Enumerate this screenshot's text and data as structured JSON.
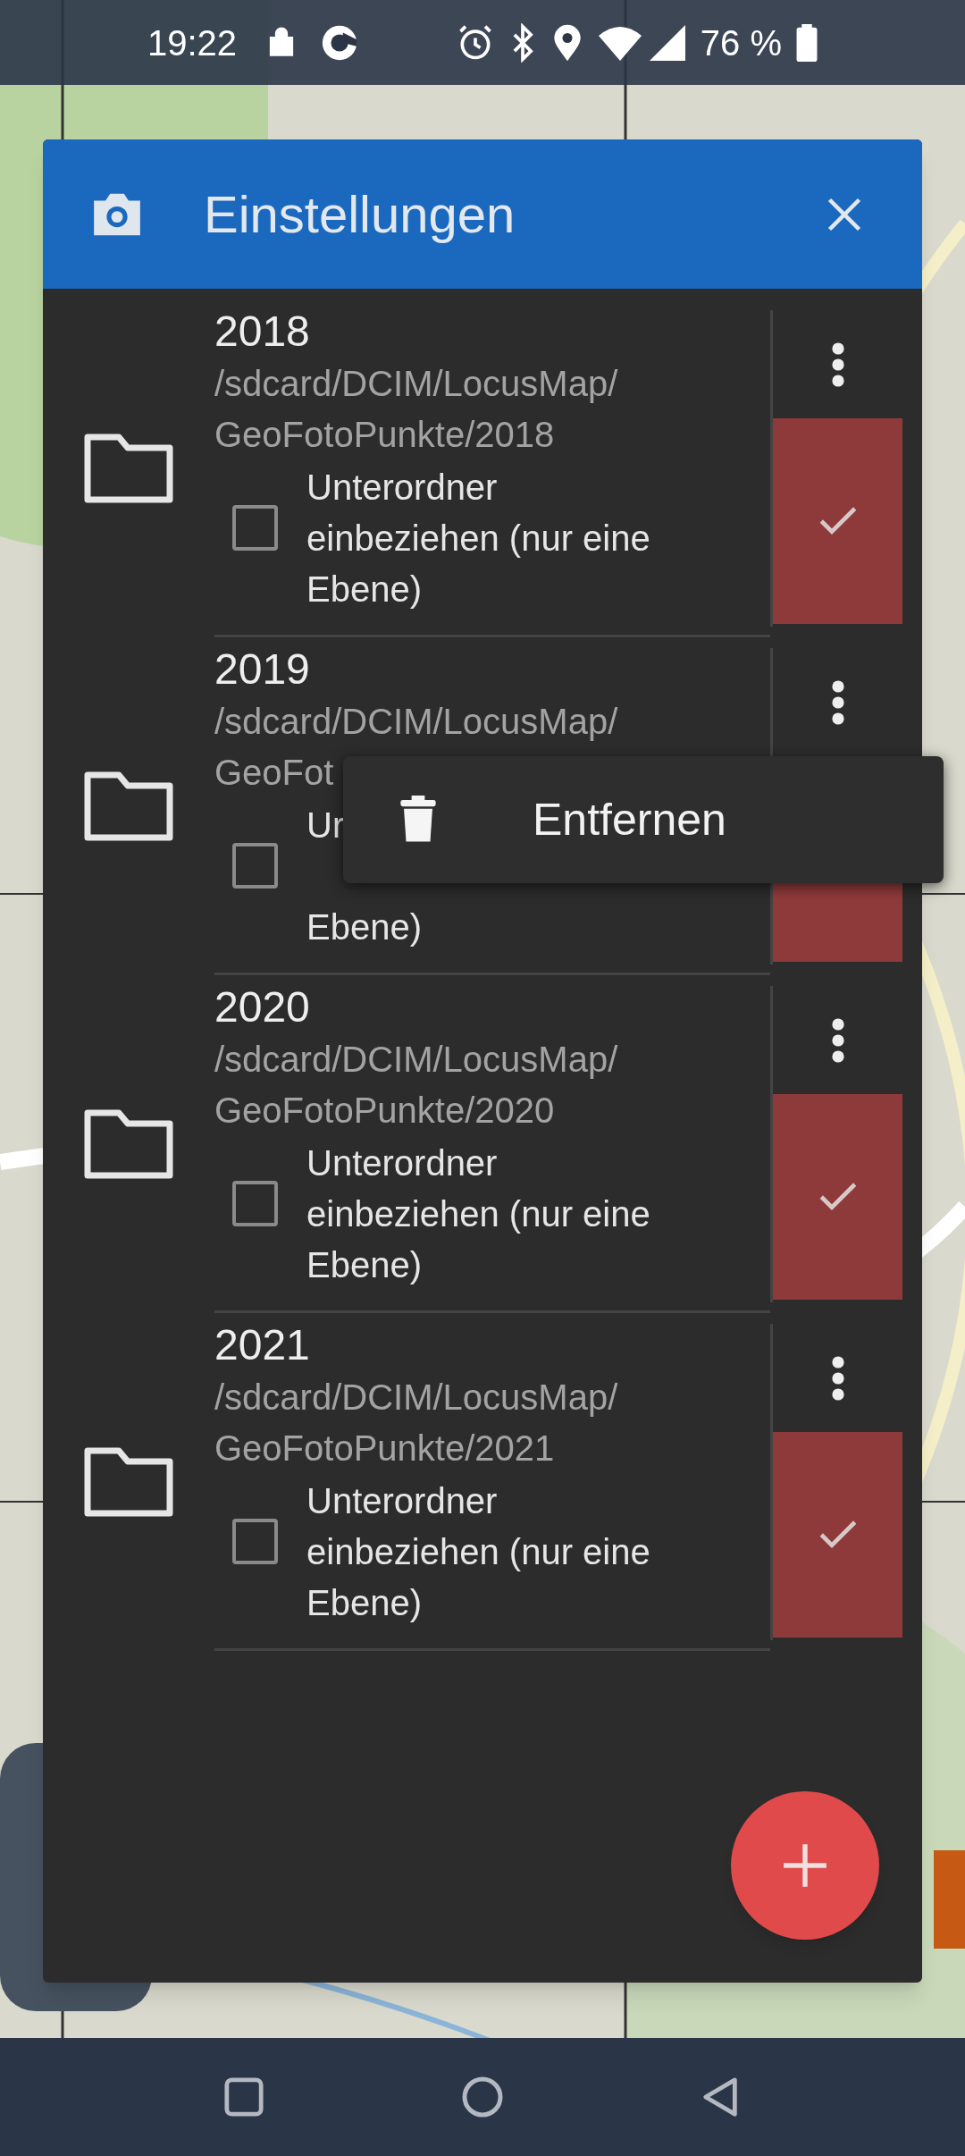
{
  "status_bar": {
    "time": "19:22",
    "battery": "76 %"
  },
  "dialog": {
    "title": "Einstellungen",
    "folders": [
      {
        "name": "2018",
        "path_lines": [
          "/sdcard/DCIM/LocusMap/",
          "GeoFotoPunkte/2018"
        ],
        "label_lines": [
          "Unterordner",
          "einbeziehen (nur eine",
          "Ebene)"
        ],
        "checked": false,
        "selected": true
      },
      {
        "name": "2019",
        "path_lines": [
          "/sdcard/DCIM/LocusMap/",
          "GeoFot"
        ],
        "label_lines": [
          "Ur",
          "Ebene)"
        ],
        "checked": false,
        "selected": true,
        "menu_open": true
      },
      {
        "name": "2020",
        "path_lines": [
          "/sdcard/DCIM/LocusMap/",
          "GeoFotoPunkte/2020"
        ],
        "label_lines": [
          "Unterordner",
          "einbeziehen (nur eine",
          "Ebene)"
        ],
        "checked": false,
        "selected": true
      },
      {
        "name": "2021",
        "path_lines": [
          "/sdcard/DCIM/LocusMap/",
          "GeoFotoPunkte/2021"
        ],
        "label_lines": [
          "Unterordner",
          "einbeziehen (nur eine",
          "Ebene)"
        ],
        "checked": false,
        "selected": true
      }
    ],
    "popup_menu": {
      "items": [
        {
          "label": "Entfernen"
        }
      ]
    }
  }
}
